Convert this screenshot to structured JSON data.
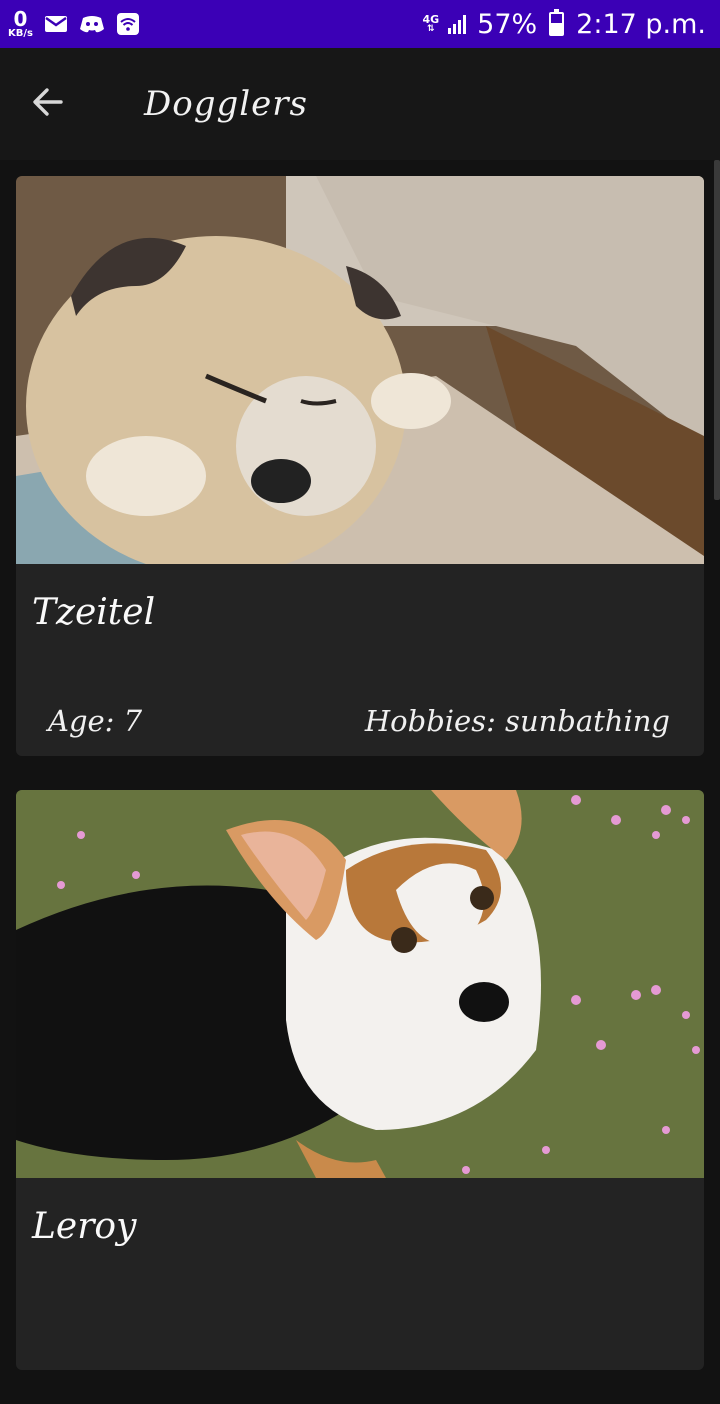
{
  "status_bar": {
    "speed_value": "0",
    "speed_unit": "KB/s",
    "network": "4G",
    "battery_percent": "57%",
    "battery_level": 0.57,
    "time": "2:17 p.m.",
    "icons": [
      "mail-icon",
      "discord-icon",
      "wifi-icon",
      "signal-icon",
      "battery-icon"
    ]
  },
  "app_bar": {
    "back_icon": "arrow-left-icon",
    "title": "Dogglers"
  },
  "dogs": [
    {
      "name": "Tzeitel",
      "age": "Age: 7",
      "hobbies": "Hobbies: sunbathing"
    },
    {
      "name": "Leroy"
    }
  ]
}
